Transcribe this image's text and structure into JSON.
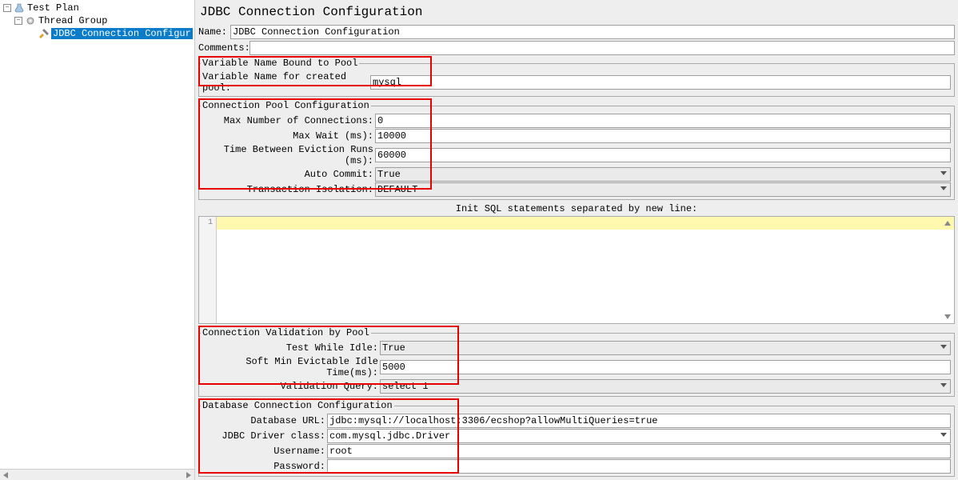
{
  "tree": {
    "root": "Test Plan",
    "group": "Thread Group",
    "selected": "JDBC Connection Configur"
  },
  "title": "JDBC Connection Configuration",
  "name_label": "Name:",
  "name_value": "JDBC Connection Configuration",
  "comments_label": "Comments:",
  "comments_value": "",
  "var_pool": {
    "legend": "Variable Name Bound to Pool",
    "label": "Variable Name for created pool:",
    "value": "mysql"
  },
  "conn_pool": {
    "legend": "Connection Pool Configuration",
    "max_conn_label": "Max Number of Connections:",
    "max_conn_value": "0",
    "max_wait_label": "Max Wait (ms):",
    "max_wait_value": "10000",
    "eviction_label": "Time Between Eviction Runs (ms):",
    "eviction_value": "60000",
    "auto_commit_label": "Auto Commit:",
    "auto_commit_value": "True",
    "tx_iso_label": "Transaction Isolation:",
    "tx_iso_value": "DEFAULT"
  },
  "init_sql_label": "Init SQL statements separated by new line:",
  "editor_line": "1",
  "validation": {
    "legend": "Connection Validation by Pool",
    "test_idle_label": "Test While Idle:",
    "test_idle_value": "True",
    "soft_min_label": "Soft Min Evictable Idle Time(ms):",
    "soft_min_value": "5000",
    "val_query_label": "Validation Query:",
    "val_query_value": "select 1"
  },
  "db": {
    "legend": "Database Connection Configuration",
    "url_label": "Database URL:",
    "url_value": "jdbc:mysql://localhost:3306/ecshop?allowMultiQueries=true",
    "driver_label": "JDBC Driver class:",
    "driver_value": "com.mysql.jdbc.Driver",
    "user_label": "Username:",
    "user_value": "root",
    "pass_label": "Password:",
    "pass_value": ""
  }
}
